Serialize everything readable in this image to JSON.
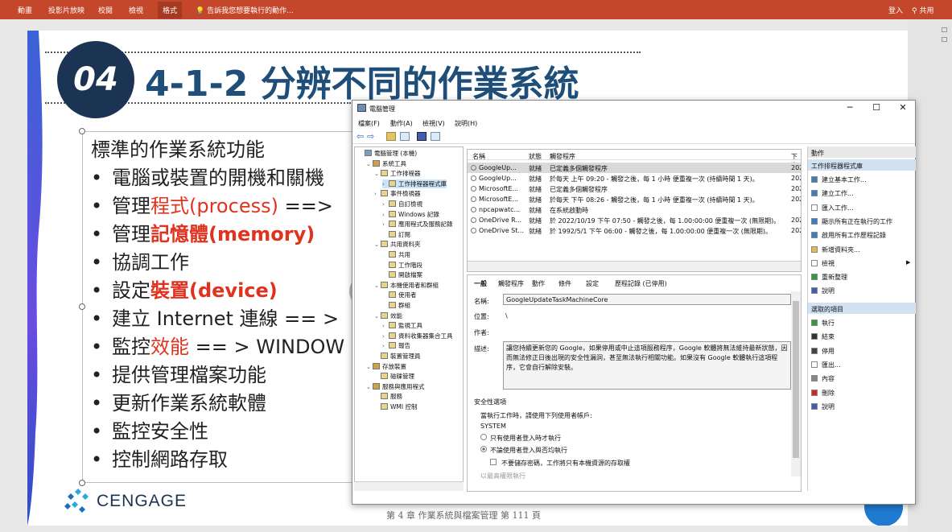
{
  "ribbon": {
    "tabs": [
      "動畫",
      "投影片放映",
      "校閱",
      "檢視",
      "格式"
    ],
    "active_tab": "格式",
    "tell_me": "告訴我您想要執行的動作...",
    "sign_in": "登入",
    "share": "共用",
    "color": "#c4462b"
  },
  "slide": {
    "number_badge": "04",
    "title": "4-1-2 分辨不同的作業系統",
    "heading": "標準的作業系統功能",
    "bullets": [
      {
        "parts": [
          {
            "text": "電腦或裝置的開機和關機",
            "style": "plain"
          }
        ]
      },
      {
        "parts": [
          {
            "text": "管理",
            "style": "plain"
          },
          {
            "text": "程式(process)",
            "style": "red"
          },
          {
            "text": "  ==>",
            "style": "plain"
          }
        ]
      },
      {
        "parts": [
          {
            "text": "管理",
            "style": "plain"
          },
          {
            "text": "記憶體(memory)",
            "style": "redb"
          }
        ]
      },
      {
        "parts": [
          {
            "text": "協調工作",
            "style": "plain"
          }
        ]
      },
      {
        "parts": [
          {
            "text": "設定",
            "style": "plain"
          },
          {
            "text": "裝置(device)",
            "style": "redb"
          }
        ]
      },
      {
        "parts": [
          {
            "text": "建立 Internet 連線   == >",
            "style": "plain"
          }
        ]
      },
      {
        "parts": [
          {
            "text": "監控",
            "style": "plain"
          },
          {
            "text": "效能",
            "style": "red"
          },
          {
            "text": "  == > WINDOW",
            "style": "plain"
          }
        ]
      },
      {
        "parts": [
          {
            "text": "提供管理檔案功能",
            "style": "plain"
          }
        ]
      },
      {
        "parts": [
          {
            "text": "更新作業系統軟體",
            "style": "plain"
          }
        ]
      },
      {
        "parts": [
          {
            "text": "監控安全性",
            "style": "plain"
          }
        ]
      },
      {
        "parts": [
          {
            "text": "控制網路存取",
            "style": "plain"
          }
        ]
      }
    ],
    "bullet_glyph": "•",
    "brand": "CENGAGE",
    "footer": "第 4 章  作業系統與檔案管理  第 111 頁",
    "colors": {
      "title": "#1f4e79",
      "badge": "#1c3453",
      "highlight": "#e0331f"
    }
  },
  "window": {
    "title": "電腦管理",
    "controls": {
      "minimize": "─",
      "maximize": "☐",
      "close": "✕"
    },
    "menu": [
      "檔案(F)",
      "動作(A)",
      "檢視(V)",
      "說明(H)"
    ],
    "tree": [
      {
        "label": "電腦管理 (本機)",
        "level": 0,
        "arrow": ""
      },
      {
        "label": "系統工具",
        "level": 1,
        "arrow": "⌄"
      },
      {
        "label": "工作排程器",
        "level": 2,
        "arrow": "⌄"
      },
      {
        "label": "工作排程器程式庫",
        "level": 3,
        "arrow": "›",
        "selected": true
      },
      {
        "label": "事件檢視器",
        "level": 2,
        "arrow": "›"
      },
      {
        "label": "自訂檢視",
        "level": 3,
        "arrow": "›"
      },
      {
        "label": "Windows 記錄",
        "level": 3,
        "arrow": "›"
      },
      {
        "label": "應用程式及服務記錄",
        "level": 3,
        "arrow": "›"
      },
      {
        "label": "訂閱",
        "level": 3,
        "arrow": ""
      },
      {
        "label": "共用資料夾",
        "level": 2,
        "arrow": "⌄"
      },
      {
        "label": "共用",
        "level": 3,
        "arrow": ""
      },
      {
        "label": "工作階段",
        "level": 3,
        "arrow": ""
      },
      {
        "label": "開啟檔案",
        "level": 3,
        "arrow": ""
      },
      {
        "label": "本機使用者和群組",
        "level": 2,
        "arrow": "⌄"
      },
      {
        "label": "使用者",
        "level": 3,
        "arrow": ""
      },
      {
        "label": "群組",
        "level": 3,
        "arrow": ""
      },
      {
        "label": "效能",
        "level": 2,
        "arrow": "⌄"
      },
      {
        "label": "監視工具",
        "level": 3,
        "arrow": "›"
      },
      {
        "label": "資料收集器集合工具",
        "level": 3,
        "arrow": "›"
      },
      {
        "label": "報告",
        "level": 3,
        "arrow": "›"
      },
      {
        "label": "裝置管理員",
        "level": 2,
        "arrow": ""
      },
      {
        "label": "存放裝置",
        "level": 1,
        "arrow": "⌄"
      },
      {
        "label": "磁碟管理",
        "level": 2,
        "arrow": ""
      },
      {
        "label": "服務與應用程式",
        "level": 1,
        "arrow": "⌄"
      },
      {
        "label": "服務",
        "level": 2,
        "arrow": ""
      },
      {
        "label": "WMI 控制",
        "level": 2,
        "arrow": ""
      }
    ],
    "task_columns": [
      "名稱",
      "狀態",
      "觸發程序",
      "下次"
    ],
    "tasks": [
      {
        "name": "GoogleUp...",
        "status": "就緒",
        "trigger": "已定義多個觸發程序",
        "next": "202",
        "selected": true
      },
      {
        "name": "GoogleUp...",
        "status": "就緒",
        "trigger": "於每天 上午 09:20 - 觸發之後，每 1 小時 便重複一次 (持續時間 1 天)。",
        "next": "202"
      },
      {
        "name": "MicrosoftE...",
        "status": "就緒",
        "trigger": "已定義多個觸發程序",
        "next": "202"
      },
      {
        "name": "MicrosoftE...",
        "status": "就緒",
        "trigger": "於每天 下午 08:26 - 觸發之後，每 1 小時 便重複一次 (持續時間 1 天)。",
        "next": "202"
      },
      {
        "name": "npcapwatc...",
        "status": "就緒",
        "trigger": "在系統啟動時",
        "next": ""
      },
      {
        "name": "OneDrive R...",
        "status": "就緒",
        "trigger": "於 2022/10/19 下午 07:50 - 觸發之後，每 1.00:00:00 便重複一次 (無限期)。",
        "next": "202"
      },
      {
        "name": "OneDrive St...",
        "status": "就緒",
        "trigger": "於 1992/5/1 下午 06:00 - 觸發之後，每 1.00:00:00 便重複一次 (無限期)。",
        "next": "202"
      }
    ],
    "detail_tabs": [
      "一般",
      "觸發程序",
      "動作",
      "條件",
      "設定",
      "歷程記錄 (已停用)"
    ],
    "detail": {
      "name_label": "名稱:",
      "name_value": "GoogleUpdateTaskMachineCore",
      "location_label": "位置:",
      "location_value": "\\",
      "author_label": "作者:",
      "description_label": "描述:",
      "description_value": "讓您持續更新您的 Google，如果停用或中止這項服務程序，Google 軟體將無法維持最新狀態，因而無法修正日後出現的安全性漏洞，甚至無法執行相關功能。如果沒有 Google 軟體執行這項程序，它會自行解除安裝。",
      "security_title": "安全性選項",
      "run_as_label": "當執行工作時，請使用下列使用者帳戶:",
      "account": "SYSTEM",
      "option1": "只有使用者登入時才執行",
      "option2": "不論使用者登入與否均執行",
      "checkbox": "不要儲存密碼，工作將只有本機資源的存取權",
      "cutoff": "以最高權限執行"
    },
    "actions_header": "動作",
    "actions_section1": "工作排程器程式庫",
    "actions1": [
      {
        "label": "建立基本工作...",
        "icon": "create-basic-task-icon",
        "color": "#3c7fc0"
      },
      {
        "label": "建立工作...",
        "icon": "create-task-icon",
        "color": "#3c7fc0"
      },
      {
        "label": "匯入工作...",
        "icon": "import-task-icon",
        "color": "#ffffff"
      },
      {
        "label": "顯示所有正在執行的工作",
        "icon": "running-tasks-icon",
        "color": "#3c7fc0"
      },
      {
        "label": "啟用所有工作歷程記錄",
        "icon": "history-icon",
        "color": "#3c7fc0"
      },
      {
        "label": "新增資料夾...",
        "icon": "new-folder-icon",
        "color": "#e8b84a"
      },
      {
        "label": "檢視",
        "icon": "view-icon",
        "color": "#ffffff",
        "submenu": true
      },
      {
        "label": "重新整理",
        "icon": "refresh-icon",
        "color": "#2e9b3c"
      },
      {
        "label": "說明",
        "icon": "help-icon",
        "color": "#3c5fb0"
      }
    ],
    "actions_section2": "選取的項目",
    "actions2": [
      {
        "label": "執行",
        "icon": "run-icon",
        "color": "#2e9b3c"
      },
      {
        "label": "結束",
        "icon": "end-icon",
        "color": "#333333"
      },
      {
        "label": "停用",
        "icon": "disable-icon",
        "color": "#444444"
      },
      {
        "label": "匯出...",
        "icon": "export-icon",
        "color": "#ffffff"
      },
      {
        "label": "內容",
        "icon": "properties-icon",
        "color": "#888888"
      },
      {
        "label": "刪除",
        "icon": "delete-icon",
        "color": "#d9261c"
      },
      {
        "label": "說明",
        "icon": "help-icon",
        "color": "#3c5fb0"
      }
    ]
  }
}
